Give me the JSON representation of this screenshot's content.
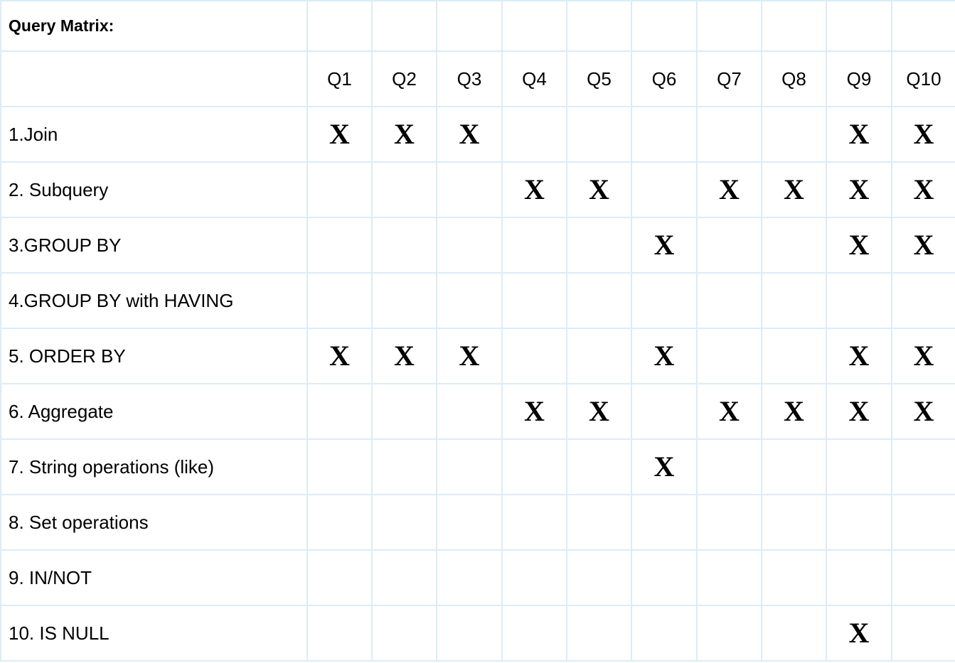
{
  "title": "Query Matrix:",
  "mark_symbol": "X",
  "columns": [
    "Q1",
    "Q2",
    "Q3",
    "Q4",
    "Q5",
    "Q6",
    "Q7",
    "Q8",
    "Q9",
    "Q10"
  ],
  "rows": [
    {
      "label": "1.Join",
      "marks": [
        true,
        true,
        true,
        false,
        false,
        false,
        false,
        false,
        true,
        true
      ]
    },
    {
      "label": "2. Subquery",
      "marks": [
        false,
        false,
        false,
        true,
        true,
        false,
        true,
        true,
        true,
        true
      ]
    },
    {
      "label": "3.GROUP BY",
      "marks": [
        false,
        false,
        false,
        false,
        false,
        true,
        false,
        false,
        true,
        true
      ]
    },
    {
      "label": "4.GROUP BY with HAVING",
      "marks": [
        false,
        false,
        false,
        false,
        false,
        false,
        false,
        false,
        false,
        false
      ]
    },
    {
      "label": "5. ORDER BY",
      "marks": [
        true,
        true,
        true,
        false,
        false,
        true,
        false,
        false,
        true,
        true
      ]
    },
    {
      "label": "6. Aggregate",
      "marks": [
        false,
        false,
        false,
        true,
        true,
        false,
        true,
        true,
        true,
        true
      ]
    },
    {
      "label": "7. String operations (like)",
      "marks": [
        false,
        false,
        false,
        false,
        false,
        true,
        false,
        false,
        false,
        false
      ]
    },
    {
      "label": "8. Set operations",
      "marks": [
        false,
        false,
        false,
        false,
        false,
        false,
        false,
        false,
        false,
        false
      ]
    },
    {
      "label": "9. IN/NOT",
      "marks": [
        false,
        false,
        false,
        false,
        false,
        false,
        false,
        false,
        false,
        false
      ]
    },
    {
      "label": "10. IS NULL",
      "marks": [
        false,
        false,
        false,
        false,
        false,
        false,
        false,
        false,
        true,
        false
      ]
    }
  ]
}
